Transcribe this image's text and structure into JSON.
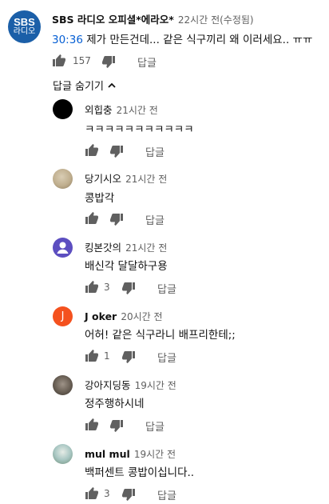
{
  "main_comment": {
    "author": "SBS 라디오 오피셜*에라오*",
    "time": "22시간 전(수정됨)",
    "timestamp_link": "30:36",
    "text": "제가 만든건데... 같은 식구끼리 왜 이러세요.. ㅠㅠ",
    "likes": "157",
    "reply_label": "답글",
    "avatar_text": [
      "SBS",
      "라디오"
    ],
    "avatar_color": "#1b5fa8"
  },
  "toggle_replies_label": "답글 숨기기",
  "replies": [
    {
      "author": "외힙충",
      "time": "21시간 전",
      "text": "ㅋㅋㅋㅋㅋㅋㅋㅋㅋㅋㅋ",
      "likes": "",
      "reply_label": "답글",
      "avatar_color": "#000000"
    },
    {
      "author": "당기시오",
      "time": "21시간 전",
      "text": "콩밥각",
      "likes": "",
      "reply_label": "답글",
      "avatar_color": "#bfae8e"
    },
    {
      "author": "킹본갓의",
      "time": "21시간 전",
      "text": "배신각 달달하구용",
      "likes": "3",
      "reply_label": "답글",
      "avatar_color": "#5c4ec0"
    },
    {
      "author": "J oker",
      "time": "20시간 전",
      "text": "어허! 같은 식구라니 배프리한테;;",
      "likes": "1",
      "reply_label": "답글",
      "avatar_color": "#f4511e",
      "avatar_letter": "J"
    },
    {
      "author": "강아지딩동",
      "time": "19시간 전",
      "text": "정주행하시네",
      "likes": "",
      "reply_label": "답글",
      "avatar_color": "#6d6358"
    },
    {
      "author": "mul mul",
      "time": "19시간 전",
      "text": "백퍼센트 콩밥이십니다..",
      "likes": "3",
      "reply_label": "답글",
      "avatar_color": "#a9c7c3"
    }
  ]
}
